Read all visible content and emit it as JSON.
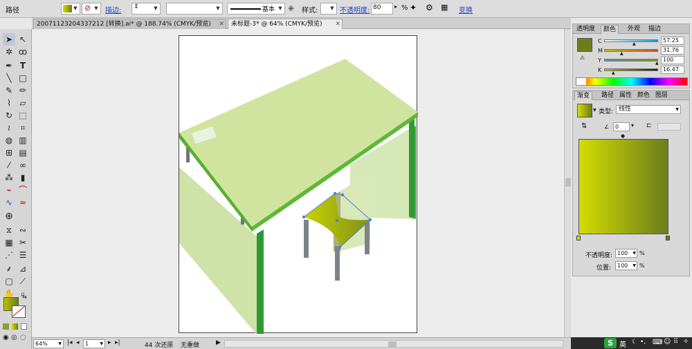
{
  "control_bar": {
    "object_label": "路径",
    "stroke_label": "描边:",
    "stroke_profile": "基本",
    "style_label": "样式:",
    "opacity_label": "不透明度:",
    "opacity_value": "80",
    "opacity_unit": "%",
    "transform_label": "变换"
  },
  "tabs": [
    {
      "label": "20071123204337212 [转换].ai* @ 188.74% (CMYK/预览)",
      "active": false
    },
    {
      "label": "未标题-3* @ 64% (CMYK/预览)",
      "active": true
    }
  ],
  "tab_close_glyph": "✕",
  "status_bar": {
    "zoom": "64%",
    "artboard": "1",
    "undo_status": "44 次还原",
    "redo_status": "无重做"
  },
  "color_panel": {
    "tabs": [
      "透明度",
      "颜色",
      "外观",
      "描边"
    ],
    "active_tab": "颜色",
    "channels": [
      {
        "name": "C",
        "value": "57.25"
      },
      {
        "name": "M",
        "value": "31.76"
      },
      {
        "name": "Y",
        "value": "100"
      },
      {
        "name": "K",
        "value": "16.47"
      }
    ],
    "swatch_color": "#6b7d1c"
  },
  "gradient_panel": {
    "tabs": [
      "渐变",
      "路径",
      "属性",
      "颜色",
      "图层"
    ],
    "active_tab": "渐变",
    "type_label": "类型:",
    "type_value": "线性",
    "angle_value": "0",
    "opacity_label": "不透明度:",
    "opacity_value": "100",
    "opacity_unit": "%",
    "position_label": "位置:",
    "position_value": "100",
    "position_unit": "%",
    "start_color": "#d4dc00",
    "end_color": "#6b7d1c"
  },
  "taskbar": {
    "ime_label": "英"
  },
  "colors": {
    "desk_top": "#d0e4a0",
    "desk_edge": "#58b030",
    "side_panel": "#cfe2a7",
    "chair_seat_start": "#c9d300",
    "leg_gray": "#7d8489"
  }
}
